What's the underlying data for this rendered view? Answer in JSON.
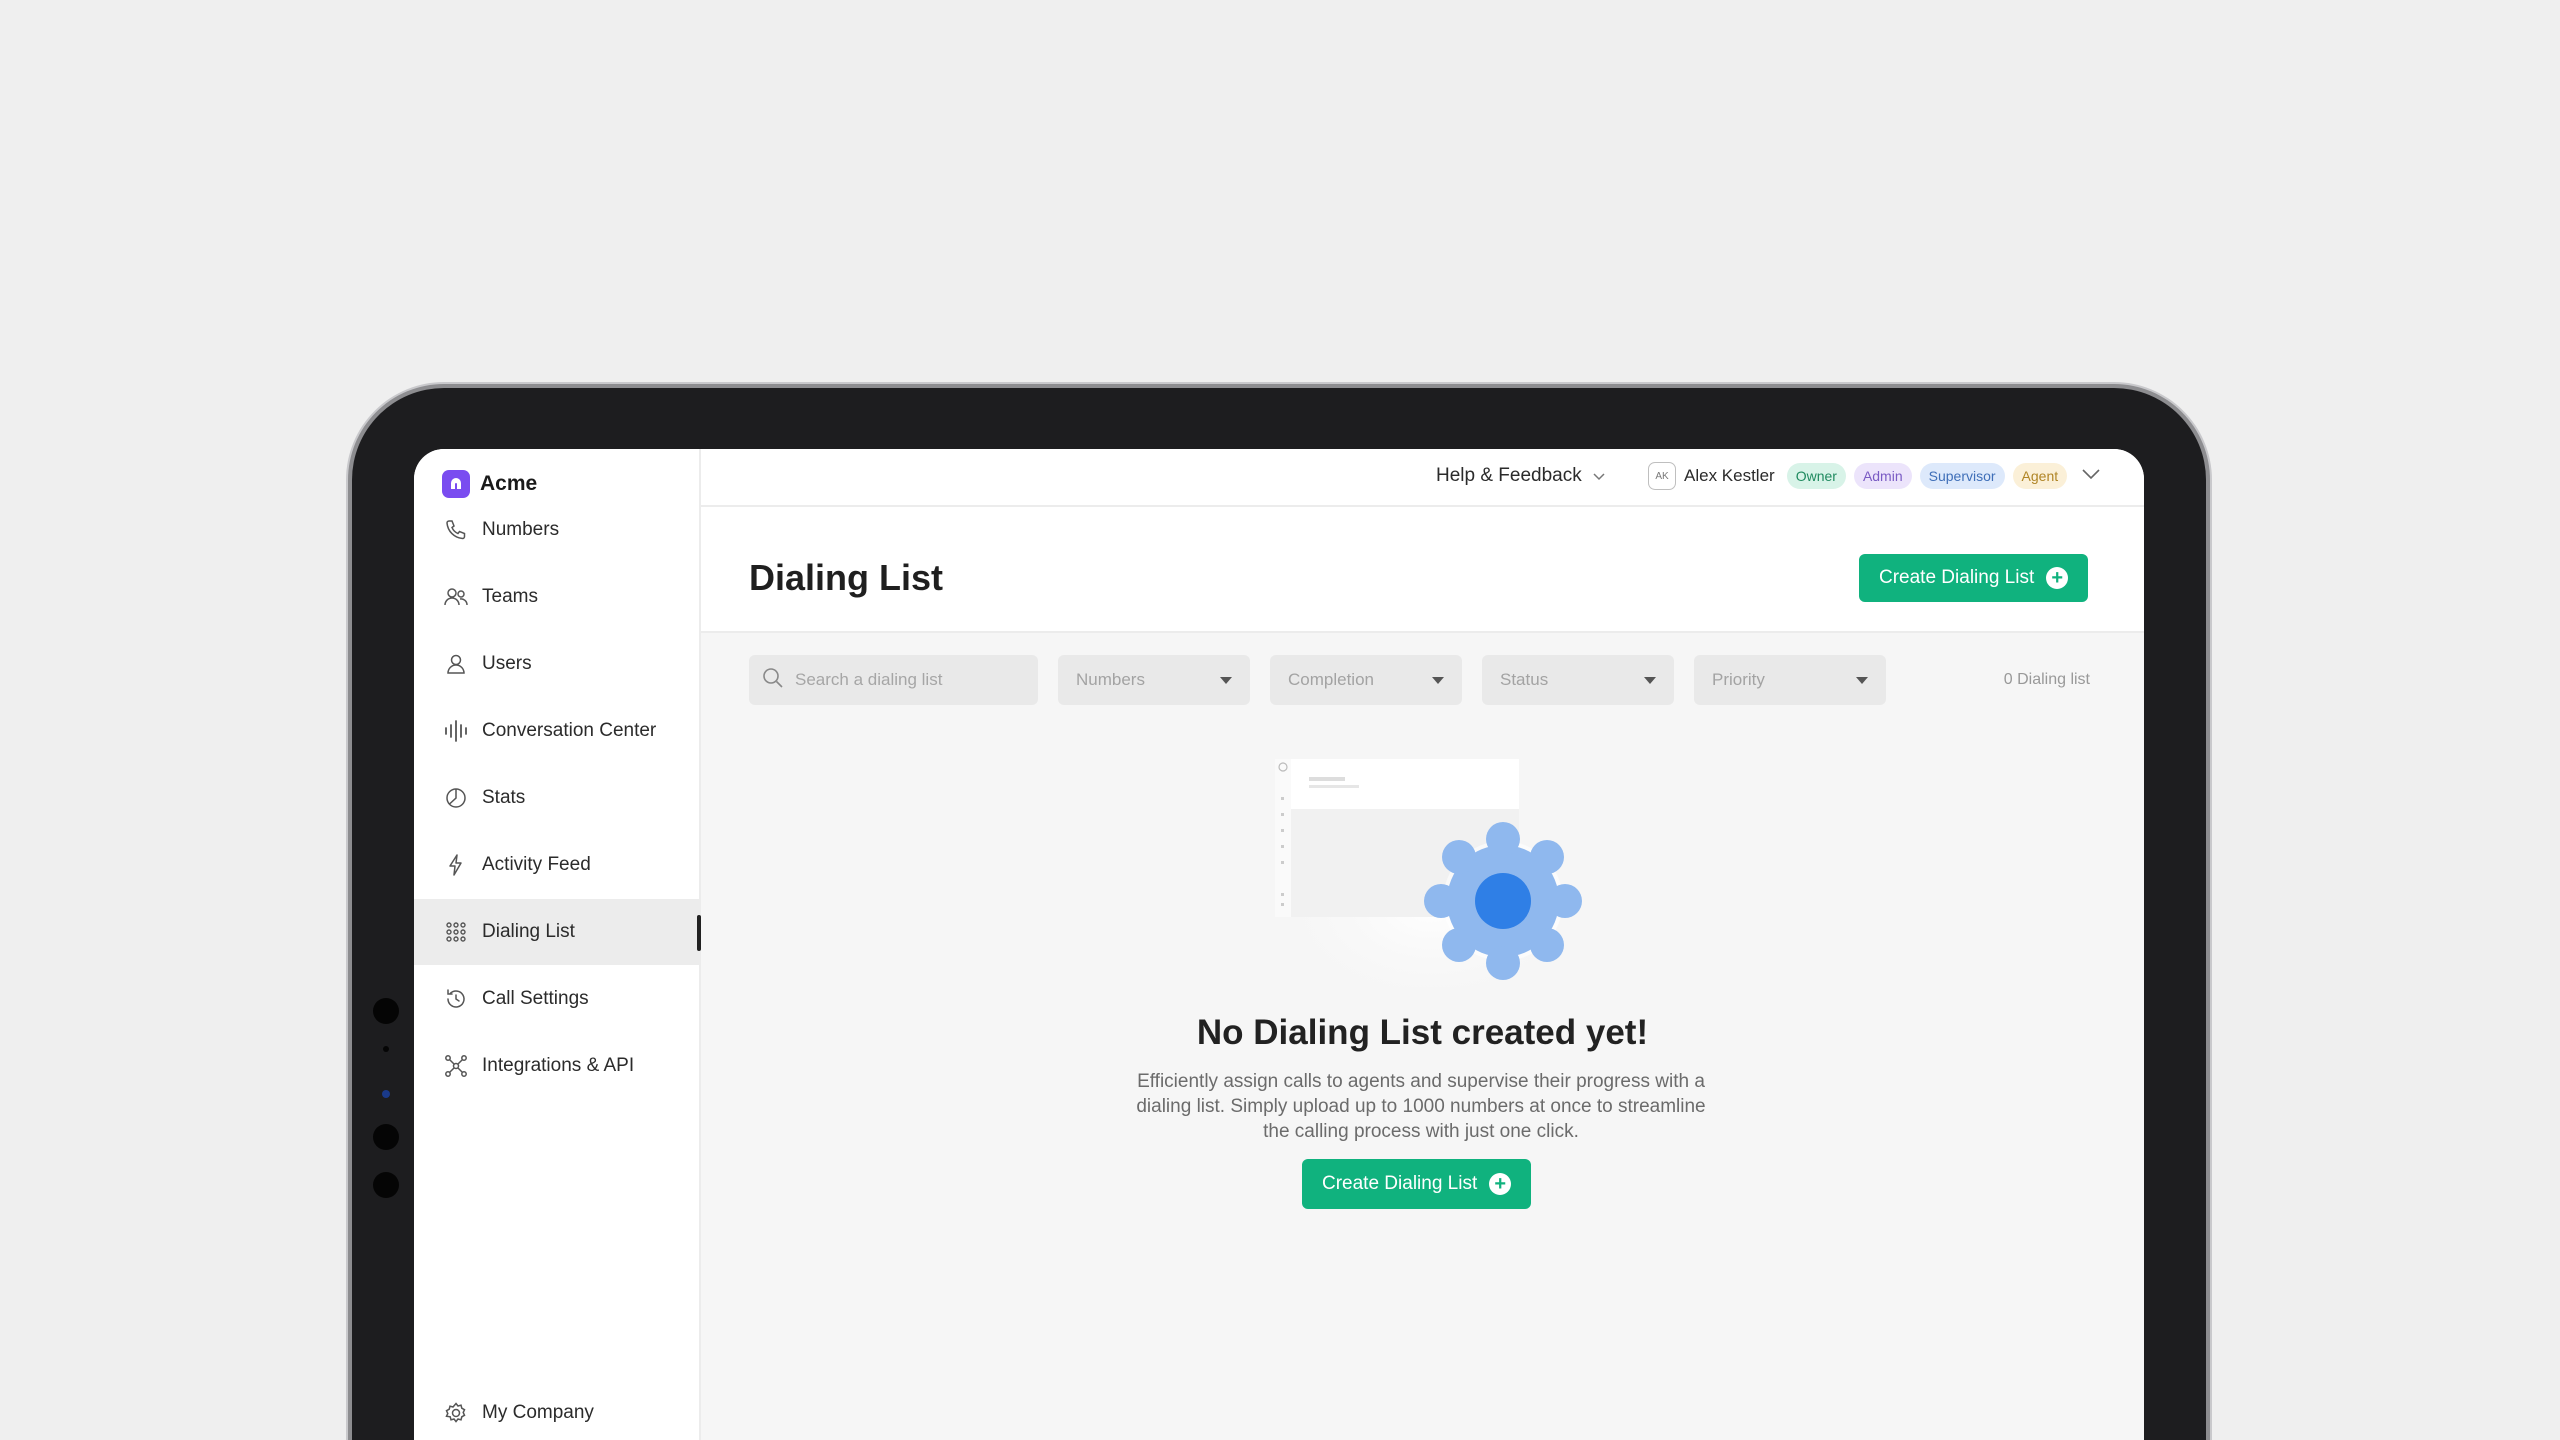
{
  "brand": {
    "name": "Acme",
    "logo_icon": "acme-logo-icon",
    "accent": "#7a4cf0"
  },
  "sidebar": {
    "items": [
      {
        "label": "Numbers",
        "icon": "phone-icon",
        "active": false
      },
      {
        "label": "Teams",
        "icon": "team-icon",
        "active": false
      },
      {
        "label": "Users",
        "icon": "user-icon",
        "active": false
      },
      {
        "label": "Conversation Center",
        "icon": "waveform-icon",
        "active": false
      },
      {
        "label": "Stats",
        "icon": "pie-chart-icon",
        "active": false
      },
      {
        "label": "Activity Feed",
        "icon": "lightning-icon",
        "active": false
      },
      {
        "label": "Dialing List",
        "icon": "keypad-icon",
        "active": true
      },
      {
        "label": "Call Settings",
        "icon": "history-icon",
        "active": false
      },
      {
        "label": "Integrations & API",
        "icon": "network-icon",
        "active": false
      }
    ],
    "bottom_item": {
      "label": "My Company",
      "icon": "gear-icon"
    }
  },
  "topbar": {
    "help_label": "Help & Feedback",
    "user": {
      "initials": "AK",
      "name": "Alex Kestler",
      "roles": [
        {
          "label": "Owner",
          "bg": "#d8f3e8",
          "fg": "#1f8a5f"
        },
        {
          "label": "Admin",
          "bg": "#ece4fb",
          "fg": "#7a5bc4"
        },
        {
          "label": "Supervisor",
          "bg": "#dde9fb",
          "fg": "#3f6fb8"
        },
        {
          "label": "Agent",
          "bg": "#fbf0d8",
          "fg": "#b08526"
        }
      ]
    }
  },
  "header": {
    "title": "Dialing List",
    "create_button": "Create Dialing List"
  },
  "filters": {
    "search_placeholder": "Search a dialing list",
    "selects": [
      "Numbers",
      "Completion",
      "Status",
      "Priority"
    ],
    "count_label": "0 Dialing list"
  },
  "empty_state": {
    "title": "No Dialing List created yet!",
    "description": "Efficiently assign calls to agents and supervise their progress with a dialing list. Simply upload up to 1000 numbers at once to streamline the calling process with just one click.",
    "button": "Create Dialing List"
  },
  "colors": {
    "primary_green": "#10b27e",
    "gear_light": "#8fb8ee",
    "gear_dark": "#2f7fe6"
  }
}
